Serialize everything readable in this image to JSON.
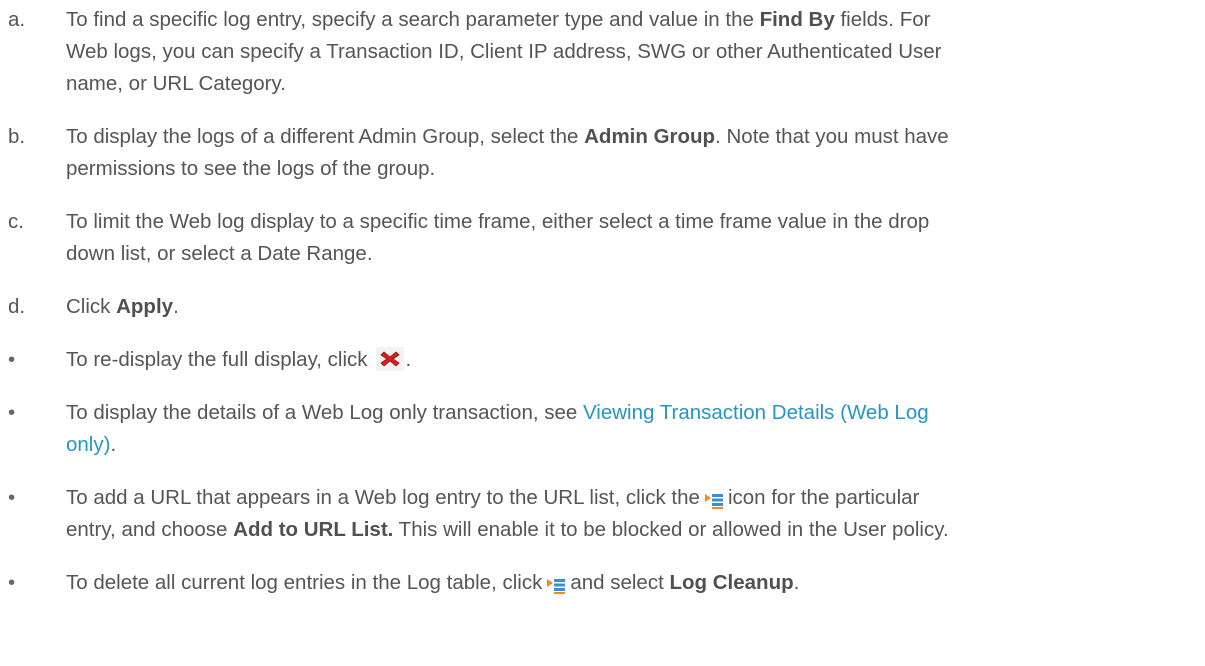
{
  "steps": [
    {
      "marker": "a.",
      "t1": "To find a specific log entry, specify a search parameter type and value in the ",
      "b1": "Find By",
      "t2": " fields. For",
      "line2": "Web logs, you can specify a Transaction ID, Client IP address, SWG or other Authenticated User",
      "line3": "name, or URL Category."
    },
    {
      "marker": "b.",
      "t1": "To display the logs of a different Admin Group, select the ",
      "b1": "Admin Group",
      "t2": ". Note that you must have",
      "line2": "permissions to see the logs of the group."
    },
    {
      "marker": "c.",
      "line1": "To limit the Web log display to a specific time frame, either select a time frame value in the drop",
      "line2": "down list, or select a Date Range."
    },
    {
      "marker": "d.",
      "t1": "Click ",
      "b1": "Apply",
      "t2": "."
    }
  ],
  "bullets": [
    {
      "marker": "•",
      "t1": "To re-display the full display, click",
      "t2": ".",
      "icon": "red-x-icon"
    },
    {
      "marker": "•",
      "t1": "To display the details of a Web Log only transaction, see ",
      "link_line1": "Viewing Transaction Details (Web Log",
      "link_line2": "only)",
      "t2": "."
    },
    {
      "marker": "•",
      "t1": "To add a URL that appears in a Web log entry to the URL list, click the",
      "t2": "icon for the particular",
      "line2_t1": "entry, and choose ",
      "line2_b1": "Add to URL List.",
      "line2_t2": " This will enable it to be blocked or allowed in the User policy.",
      "icon": "actions-menu-icon"
    },
    {
      "marker": "•",
      "t1": "To delete all current log entries in the Log table, click",
      "t2": "and select ",
      "b1": "Log Cleanup",
      "t3": ".",
      "icon": "actions-menu-icon"
    }
  ],
  "colors": {
    "text": "#555555",
    "link": "#2596c3",
    "icon_red": "#d42020",
    "icon_orange": "#f08a1c",
    "icon_blue": "#3a8ed6"
  }
}
